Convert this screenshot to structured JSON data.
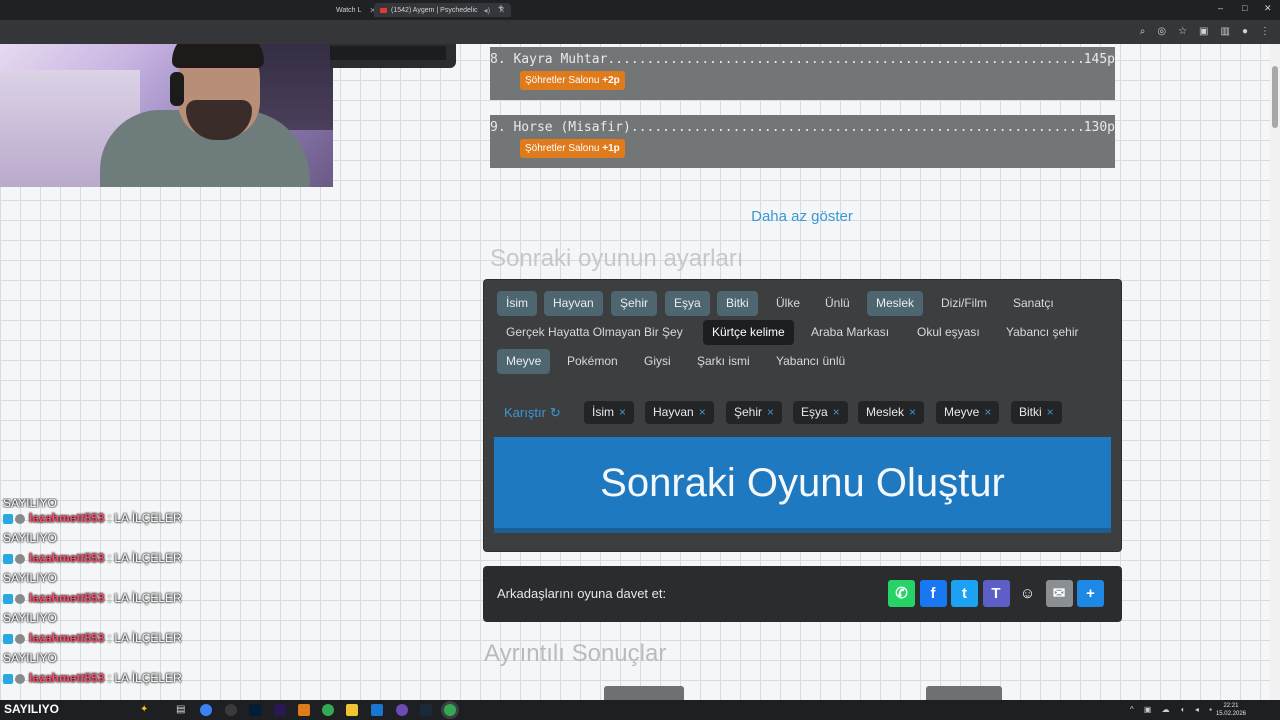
{
  "browser": {
    "tabs": [
      {
        "label": "Watch L"
      },
      {
        "label": "(1542) Aygem | Psychedelic"
      }
    ],
    "new_tab": "+",
    "window_controls": [
      "–",
      "□",
      "✕"
    ]
  },
  "rankings": [
    {
      "text": "8. Kayra Muhtar.............................................................",
      "points": "145p",
      "badge_label": "Şöhretler Salonu",
      "badge_points": "+2p"
    },
    {
      "text": "9. Horse (Misafir)..........................................................",
      "points": "130p",
      "badge_label": "Şöhretler Salonu",
      "badge_points": "+1p"
    }
  ],
  "show_less": "Daha az göster",
  "next_game": {
    "title": "Sonraki oyunun ayarları",
    "categories": [
      {
        "label": "İsim",
        "selected": true
      },
      {
        "label": "Hayvan",
        "selected": true
      },
      {
        "label": "Şehir",
        "selected": true
      },
      {
        "label": "Eşya",
        "selected": true
      },
      {
        "label": "Bitki",
        "selected": true
      },
      {
        "label": "Ülke",
        "selected": false
      },
      {
        "label": "Ünlü",
        "selected": false
      },
      {
        "label": "Meslek",
        "selected": true
      },
      {
        "label": "Dizi/Film",
        "selected": false
      },
      {
        "label": "Sanatçı",
        "selected": false
      },
      {
        "label": "Gerçek Hayatta Olmayan Bir Şey",
        "selected": false
      },
      {
        "label": "Kürtçe kelime",
        "selected": false
      },
      {
        "label": "Araba Markası",
        "selected": false
      },
      {
        "label": "Okul eşyası",
        "selected": false
      },
      {
        "label": "Yabancı şehir",
        "selected": false
      },
      {
        "label": "Meyve",
        "selected": true
      },
      {
        "label": "Pokémon",
        "selected": false
      },
      {
        "label": "Giysi",
        "selected": false
      },
      {
        "label": "Şarkı ismi",
        "selected": false
      },
      {
        "label": "Yabancı ünlü",
        "selected": false
      }
    ],
    "shuffle_label": "Karıştır",
    "shuffle_icon": "refresh-icon",
    "selected_tags": [
      "İsim",
      "Hayvan",
      "Şehir",
      "Eşya",
      "Meslek",
      "Meyve",
      "Bitki"
    ],
    "remove_symbol": "×",
    "create_button": "Sonraki Oyunu Oluştur"
  },
  "invite": {
    "text": "Arkadaşlarını oyuna davet et:",
    "share_buttons": [
      {
        "icon": "whatsapp-icon",
        "glyph": "✆",
        "color": "#25d366"
      },
      {
        "icon": "facebook-icon",
        "glyph": "f",
        "color": "#1877f2"
      },
      {
        "icon": "twitter-icon",
        "glyph": "t",
        "color": "#1da1f2"
      },
      {
        "icon": "teams-icon",
        "glyph": "T",
        "color": "#5b5fc7"
      },
      {
        "icon": "snapchat-icon",
        "glyph": "☺",
        "color": "#2a2c2e"
      },
      {
        "icon": "email-icon",
        "glyph": "✉",
        "color": "#8a8f93"
      },
      {
        "icon": "share-plus-icon",
        "glyph": "+",
        "color": "#1e88e5"
      }
    ]
  },
  "details_title": "Ayrıntılı Sonuçlar",
  "chat": {
    "continuation": "SAYILIYO",
    "messages": [
      {
        "user": "lazahmett553",
        "text": ": LA İLÇELER"
      },
      {
        "user": "lazahmett553",
        "text": ": LA İLÇELER"
      },
      {
        "user": "lazahmett553",
        "text": ": LA İLÇELER"
      },
      {
        "user": "lazahmett553",
        "text": ": LA İLÇELER"
      },
      {
        "user": "lazahmett553",
        "text": ": LA İLÇELER"
      }
    ]
  },
  "taskbar": {
    "left_text": "SAYILIYO",
    "time": "22:21",
    "date": "15.02.2026"
  }
}
